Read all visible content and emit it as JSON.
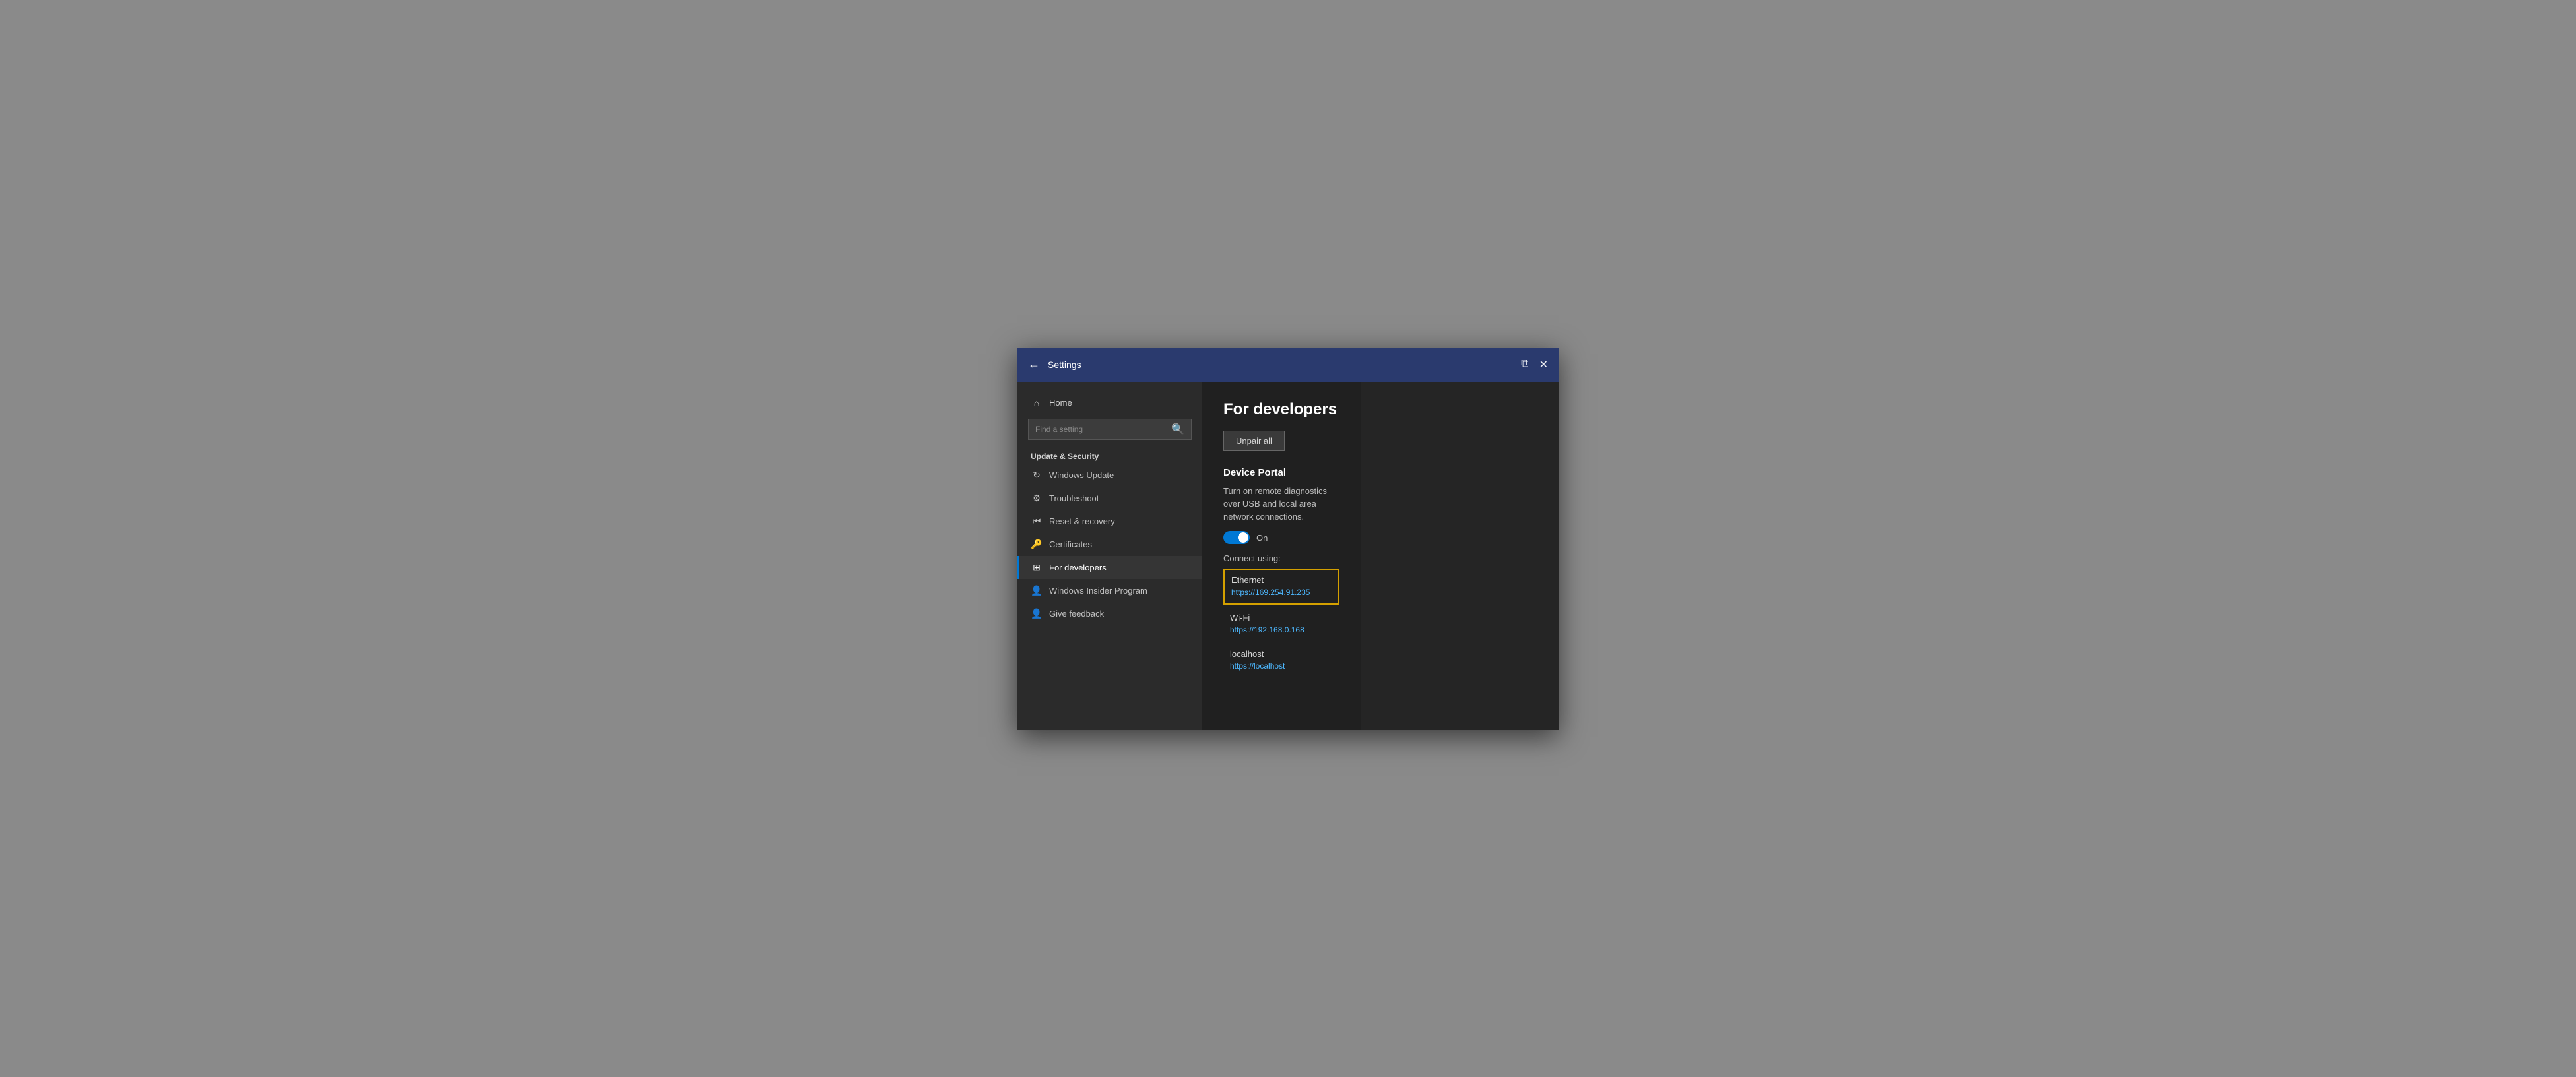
{
  "titlebar": {
    "title": "Settings",
    "back_label": "←",
    "minimize_icon": "⬜",
    "close_icon": "✕"
  },
  "sidebar": {
    "home_label": "Home",
    "search_placeholder": "Find a setting",
    "section_title": "Update & Security",
    "items": [
      {
        "id": "windows-update",
        "label": "Windows Update",
        "icon": "↻"
      },
      {
        "id": "troubleshoot",
        "label": "Troubleshoot",
        "icon": "🔧"
      },
      {
        "id": "reset-recovery",
        "label": "Reset & recovery",
        "icon": "⏮"
      },
      {
        "id": "certificates",
        "label": "Certificates",
        "icon": "🔑"
      },
      {
        "id": "for-developers",
        "label": "For developers",
        "icon": "⊞",
        "active": true
      },
      {
        "id": "windows-insider",
        "label": "Windows Insider Program",
        "icon": "👤"
      },
      {
        "id": "give-feedback",
        "label": "Give feedback",
        "icon": "👤"
      }
    ]
  },
  "main": {
    "title": "For developers",
    "unpair_button": "Unpair all",
    "device_portal": {
      "section_title": "Device Portal",
      "description": "Turn on remote diagnostics over USB and local area network connections.",
      "toggle_state": "On",
      "connect_using": "Connect using:",
      "connections": [
        {
          "name": "Ethernet",
          "url": "https://169.254.91.235",
          "highlighted": true
        },
        {
          "name": "Wi-Fi",
          "url": "https://192.168.0.168",
          "highlighted": false
        },
        {
          "name": "localhost",
          "url": "https://localhost",
          "highlighted": false
        }
      ]
    }
  },
  "icons": {
    "home": "⌂",
    "windows_update": "↻",
    "troubleshoot": "🔧",
    "reset": "⏮",
    "certificates": "🔑",
    "developers": "▦",
    "insider": "👤",
    "feedback": "👤",
    "search": "🔍",
    "back": "←",
    "snap": "⧉",
    "close": "✕"
  },
  "colors": {
    "accent": "#0078d4",
    "highlight_border": "#d4a000",
    "link": "#4db8ff",
    "active_indicator": "#0078d4"
  }
}
